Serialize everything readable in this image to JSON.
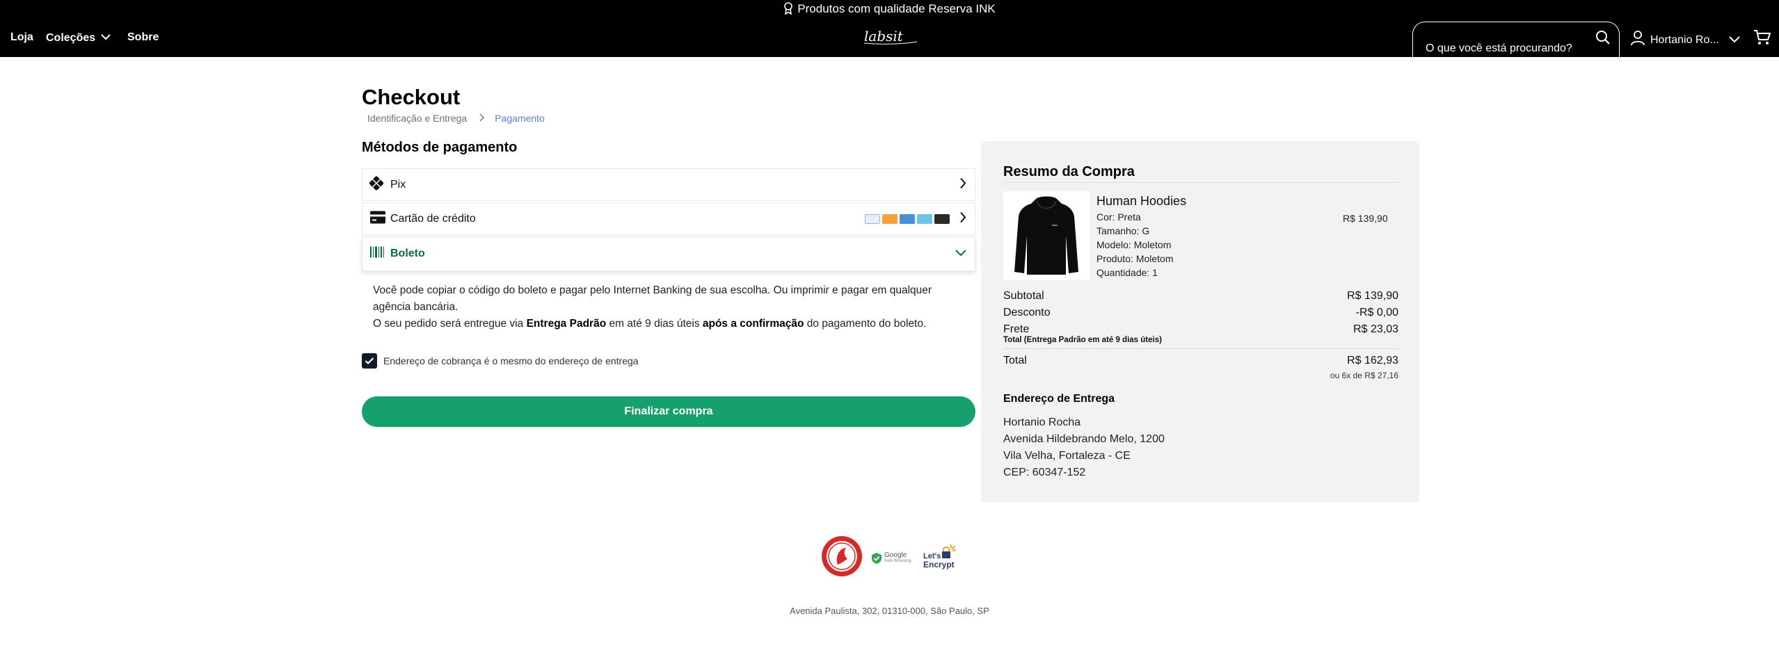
{
  "topbar": {
    "promo_text": "Produtos com qualidade Reserva INK",
    "nav": {
      "loja": "Loja",
      "colecoes": "Coleções",
      "sobre": "Sobre"
    },
    "logo_text": "labsit",
    "search_placeholder": "O que você está procurando?",
    "user_name": "Hortanio Ro..."
  },
  "checkout": {
    "title": "Checkout",
    "breadcrumb": {
      "step1": "Identificação e Entrega",
      "step2": "Pagamento"
    },
    "payment_section_title": "Métodos de pagamento",
    "methods": {
      "pix": "Pix",
      "card": "Cartão de crédito",
      "boleto": "Boleto"
    },
    "boleto_info": {
      "line1": "Você pode copiar o código do boleto e pagar pelo Internet Banking de sua escolha. Ou imprimir e pagar em qualquer agência bancária.",
      "line2_pre": "O seu pedido será entregue via ",
      "line2_bold1": "Entrega Padrão",
      "line2_mid": " em até 9 dias úteis ",
      "line2_bold2": "após a confirmação",
      "line2_post": " do pagamento do boleto."
    },
    "billing_same_label": "Endereço de cobrança é o mesmo do endereço de entrega",
    "billing_same_checked": true,
    "finish_button": "Finalizar compra"
  },
  "summary": {
    "title": "Resumo da Compra",
    "product": {
      "name": "Human Hoodies",
      "price": "R$ 139,90",
      "color": "Cor: Preta",
      "size": "Tamanho: G",
      "model": "Modelo: Moletom",
      "type": "Produto: Moletom",
      "qty": "Quantidade: 1"
    },
    "subtotal_label": "Subtotal",
    "subtotal_value": "R$ 139,90",
    "discount_label": "Desconto",
    "discount_value": "-R$ 0,00",
    "shipping_label": "Frete",
    "shipping_value": "R$ 23,03",
    "shipping_note": "Total (Entrega Padrão em até 9 dias úteis)",
    "total_label": "Total",
    "total_value": "R$ 162,93",
    "installments": "ou 6x de R$ 27,16",
    "address_title": "Endereço de Entrega",
    "address": {
      "name": "Hortanio Rocha",
      "street": "Avenida Hildebrando Melo, 1200",
      "city": "Vila Velha, Fortaleza - CE",
      "zip": "CEP: 60347-152"
    }
  },
  "footer": {
    "google_badge": "Google",
    "google_sub": "Safe Browsing",
    "letsencrypt": "Let's Encrypt",
    "address": "Avenida Paulista, 302, 01310-000, São Paulo, SP"
  },
  "colors": {
    "accent_green": "#16a06e",
    "boleto_green": "#0b6b44",
    "breadcrumb_active": "#5a7fd6",
    "topbar": "#000000",
    "summary_bg": "#f2f2f3"
  }
}
